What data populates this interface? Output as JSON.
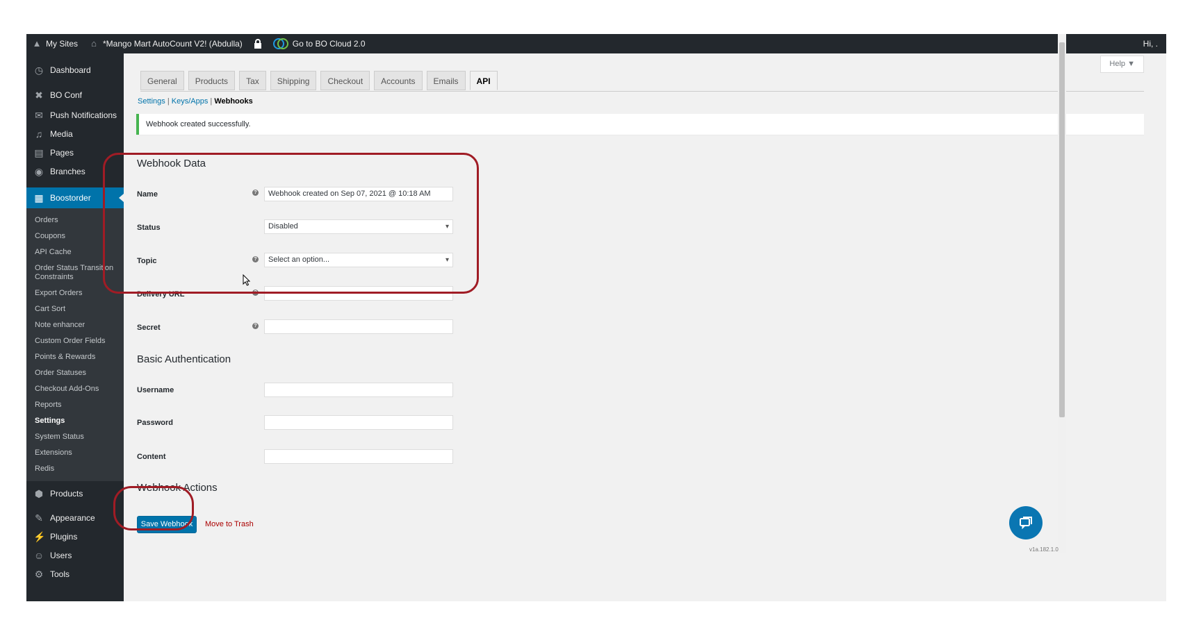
{
  "adminbar": {
    "my_sites": "My Sites",
    "site_name": "*Mango Mart AutoCount V2! (Abdulla)",
    "bo_cloud": "Go to BO Cloud 2.0",
    "greeting": "Hi, ."
  },
  "sidebar": {
    "dashboard": "Dashboard",
    "bo_conf": "BO Conf",
    "push": "Push Notifications",
    "media": "Media",
    "pages": "Pages",
    "branches": "Branches",
    "boostorder": "Boostorder",
    "sub": [
      "Orders",
      "Coupons",
      "API Cache",
      "Order Status Transition Constraints",
      "Export Orders",
      "Cart Sort",
      "Note enhancer",
      "Custom Order Fields",
      "Points & Rewards",
      "Order Statuses",
      "Checkout Add-Ons",
      "Reports",
      "Settings",
      "System Status",
      "Extensions",
      "Redis"
    ],
    "products": "Products",
    "appearance": "Appearance",
    "plugins": "Plugins",
    "users": "Users",
    "tools": "Tools"
  },
  "help": "Help ▼",
  "tabs": [
    "General",
    "Products",
    "Tax",
    "Shipping",
    "Checkout",
    "Accounts",
    "Emails",
    "API"
  ],
  "subsub": {
    "settings": "Settings",
    "keys": "Keys/Apps",
    "webhooks": "Webhooks",
    "sep": "|"
  },
  "notice": "Webhook created successfully.",
  "webhook_data": {
    "heading": "Webhook Data",
    "name_label": "Name",
    "name_value": "Webhook created on Sep 07, 2021 @ 10:18 AM",
    "status_label": "Status",
    "status_value": "Disabled",
    "topic_label": "Topic",
    "topic_value": "Select an option...",
    "url_label": "Delivery URL",
    "secret_label": "Secret"
  },
  "basic_auth": {
    "heading": "Basic Authentication",
    "username_label": "Username",
    "password_label": "Password",
    "content_label": "Content"
  },
  "actions": {
    "heading": "Webhook Actions",
    "save": "Save Webhook",
    "trash": "Move to Trash"
  },
  "version": "v1a.182.1.0",
  "colors": {
    "accent": "#0073aa",
    "annotation": "#a01c25",
    "sidebar": "#23282d",
    "notice_border": "#46b450"
  }
}
